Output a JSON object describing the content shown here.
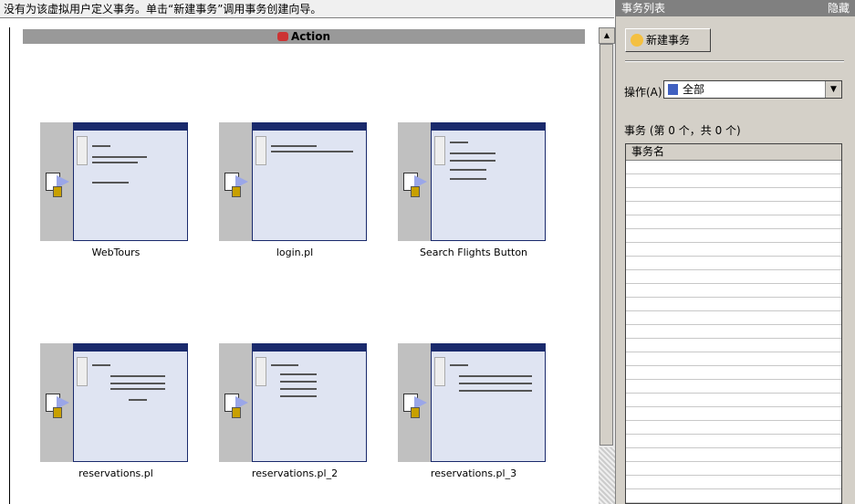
{
  "message_bar": "没有为该虚拟用户定义事务。单击“新建事务”调用事务创建向导。",
  "action_header": "Action",
  "thumbnails": [
    {
      "label": "WebTours"
    },
    {
      "label": "login.pl"
    },
    {
      "label": "Search Flights Button"
    },
    {
      "label": "reservations.pl"
    },
    {
      "label": "reservations.pl_2"
    },
    {
      "label": "reservations.pl_3"
    }
  ],
  "right_panel": {
    "title": "事务列表",
    "hide_label": "隐藏",
    "new_button": "新建事务",
    "operation_label": "操作(A):",
    "operation_value": "全部",
    "transaction_count": "事务 (第 0 个，共 0 个)",
    "column_header": "事务名"
  },
  "icons": {
    "new": "new-transaction-icon",
    "op": "user-icon",
    "dropdown": "dropdown-arrow-icon",
    "action": "action-icon",
    "step": "step-icon"
  }
}
